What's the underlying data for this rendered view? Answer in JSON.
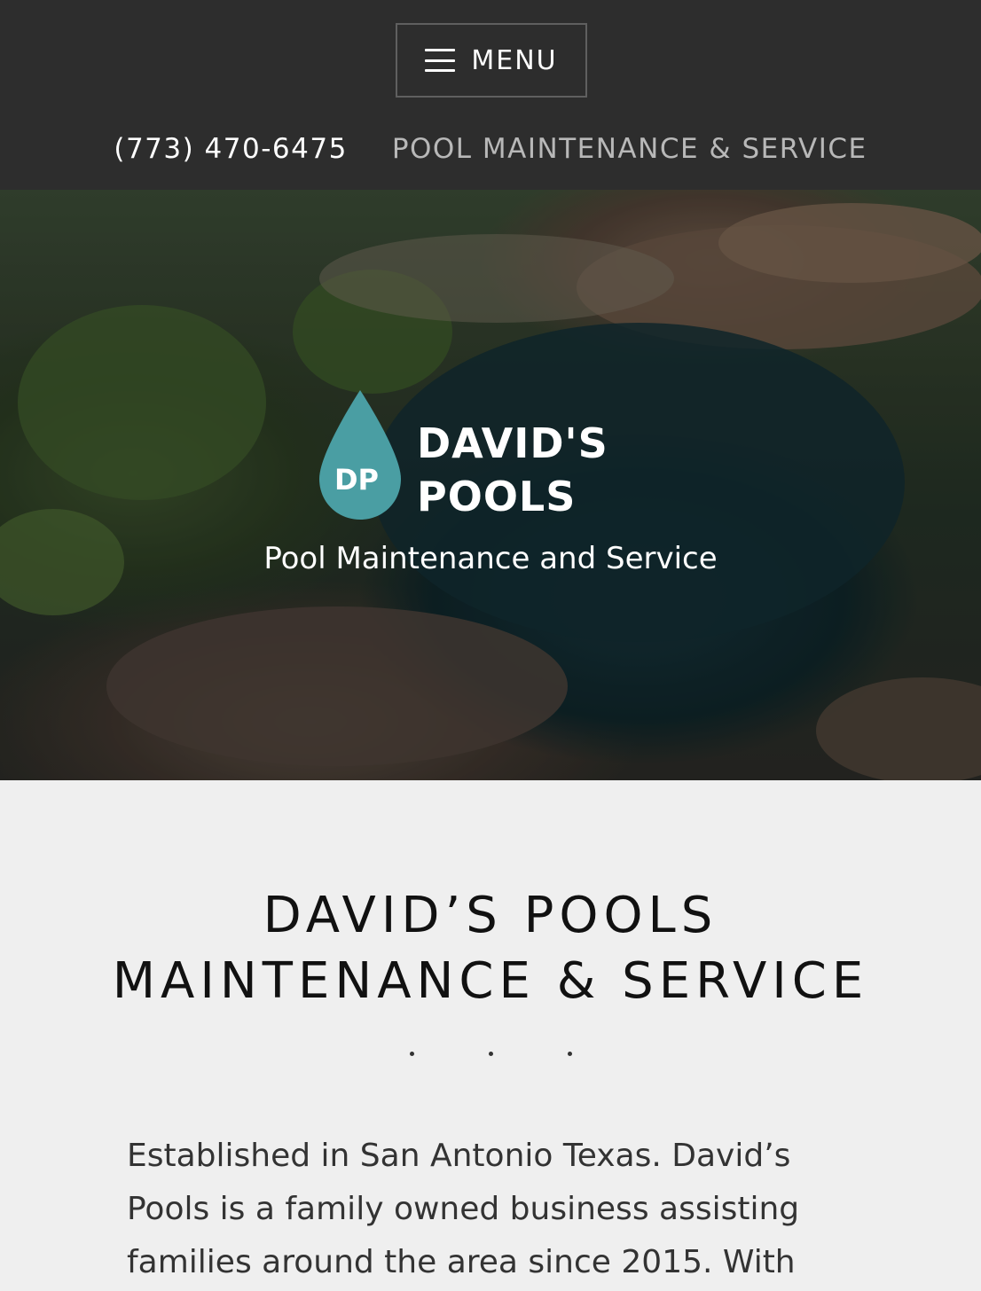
{
  "header": {
    "menu_label": "MENU",
    "phone": "(773) 470-6475",
    "service_link": "POOL MAINTENANCE & SERVICE"
  },
  "hero": {
    "logo_initials": "DP",
    "logo_line1": "DAVID'S",
    "logo_line2": "POOLS",
    "tagline": "Pool Maintenance and Service"
  },
  "content": {
    "title_line1": "DAVID’S POOLS",
    "title_line2": "MAINTENANCE & SERVICE",
    "intro": "Established in San Antonio Texas. David’s Pools is a family owned business assisting families around the area since 2015. With"
  },
  "colors": {
    "header_bg": "#2d2d2d",
    "logo_accent": "#4a9ea3",
    "page_bg": "#efefef"
  }
}
